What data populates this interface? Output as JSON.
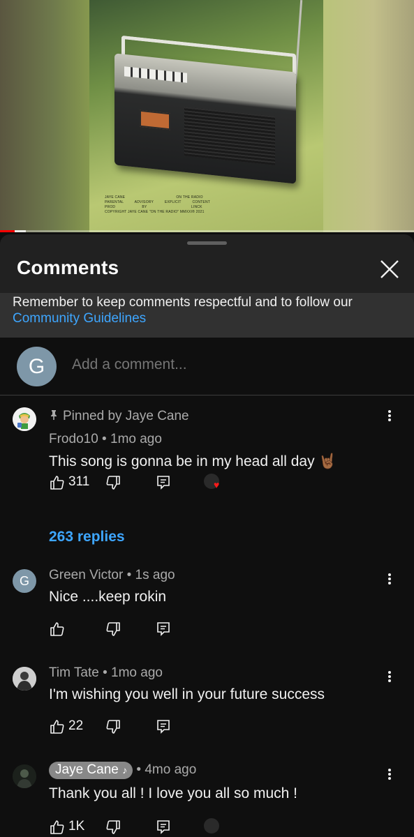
{
  "video": {
    "album_lines": [
      "JAYE CANE                                              ON THE RADIO",
      "PARENTAL          ADVISORY          EXPLICIT          CONTENT",
      "PROD                        BY                                        LINCK",
      "COPYRIGHT JAYE CANE \"ON THE RADIO\" MMXXI® 2021"
    ],
    "progress_fraction": 0.035
  },
  "sheet": {
    "title": "Comments",
    "notice_text": "Remember to keep comments respectful and to follow our ",
    "notice_link": "Community Guidelines",
    "add_avatar_letter": "G",
    "add_placeholder": "Add a comment..."
  },
  "comments": [
    {
      "pinned": "Pinned by Jaye Cane",
      "author": "Frodo10",
      "time": "1mo ago",
      "text": "This song is gonna be in my head all day 🤘🏾",
      "likes": "311",
      "replies": "263 replies"
    },
    {
      "avatar_letter": "G",
      "author": "Green Victor",
      "time": "1s ago",
      "text": "Nice ....keep rokin"
    },
    {
      "author": "Tim Tate",
      "time": "1mo ago",
      "text": "I'm wishing you well in your future success",
      "likes": "22"
    },
    {
      "author": "Jaye Cane",
      "author_badge": "♪",
      "time": "4mo ago",
      "text": "Thank you all ! I love you all so much !",
      "likes": "1K"
    }
  ],
  "colors": {
    "accent_link": "#3ea6ff",
    "progress_red": "#ff0000",
    "sheet_bg": "#212121",
    "list_bg": "#0f0f0f"
  }
}
